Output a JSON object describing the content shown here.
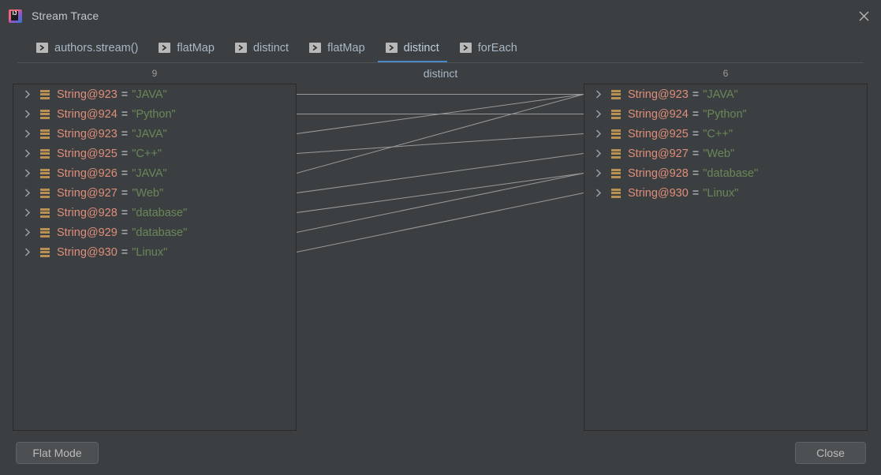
{
  "window": {
    "title": "Stream Trace",
    "app_icon": "intellij-idea-icon",
    "icon_text": "IJ",
    "close_icon": "close-icon"
  },
  "tabs": [
    {
      "label": "authors.stream()",
      "icon": "stream-step-icon",
      "active": false
    },
    {
      "label": "flatMap",
      "icon": "stream-step-icon",
      "active": false
    },
    {
      "label": "distinct",
      "icon": "stream-step-icon",
      "active": false
    },
    {
      "label": "flatMap",
      "icon": "stream-step-icon",
      "active": false
    },
    {
      "label": "distinct",
      "icon": "stream-step-icon",
      "active": true
    },
    {
      "label": "forEach",
      "icon": "stream-step-icon",
      "active": false
    }
  ],
  "stage": {
    "name": "distinct",
    "left_count": "9",
    "right_count": "6"
  },
  "left_panel": {
    "items": [
      {
        "name": "String@923",
        "eq": "=",
        "value": "\"JAVA\"",
        "icon": "string-object-icon",
        "chevron": "chevron-right-icon"
      },
      {
        "name": "String@924",
        "eq": "=",
        "value": "\"Python\"",
        "icon": "string-object-icon",
        "chevron": "chevron-right-icon"
      },
      {
        "name": "String@923",
        "eq": "=",
        "value": "\"JAVA\"",
        "icon": "string-object-icon",
        "chevron": "chevron-right-icon"
      },
      {
        "name": "String@925",
        "eq": "=",
        "value": "\"C++\"",
        "icon": "string-object-icon",
        "chevron": "chevron-right-icon"
      },
      {
        "name": "String@926",
        "eq": "=",
        "value": "\"JAVA\"",
        "icon": "string-object-icon",
        "chevron": "chevron-right-icon"
      },
      {
        "name": "String@927",
        "eq": "=",
        "value": "\"Web\"",
        "icon": "string-object-icon",
        "chevron": "chevron-right-icon"
      },
      {
        "name": "String@928",
        "eq": "=",
        "value": "\"database\"",
        "icon": "string-object-icon",
        "chevron": "chevron-right-icon"
      },
      {
        "name": "String@929",
        "eq": "=",
        "value": "\"database\"",
        "icon": "string-object-icon",
        "chevron": "chevron-right-icon"
      },
      {
        "name": "String@930",
        "eq": "=",
        "value": "\"Linux\"",
        "icon": "string-object-icon",
        "chevron": "chevron-right-icon"
      }
    ]
  },
  "right_panel": {
    "items": [
      {
        "name": "String@923",
        "eq": "=",
        "value": "\"JAVA\"",
        "icon": "string-object-icon",
        "chevron": "chevron-right-icon"
      },
      {
        "name": "String@924",
        "eq": "=",
        "value": "\"Python\"",
        "icon": "string-object-icon",
        "chevron": "chevron-right-icon"
      },
      {
        "name": "String@925",
        "eq": "=",
        "value": "\"C++\"",
        "icon": "string-object-icon",
        "chevron": "chevron-right-icon"
      },
      {
        "name": "String@927",
        "eq": "=",
        "value": "\"Web\"",
        "icon": "string-object-icon",
        "chevron": "chevron-right-icon"
      },
      {
        "name": "String@928",
        "eq": "=",
        "value": "\"database\"",
        "icon": "string-object-icon",
        "chevron": "chevron-right-icon"
      },
      {
        "name": "String@930",
        "eq": "=",
        "value": "\"Linux\"",
        "icon": "string-object-icon",
        "chevron": "chevron-right-icon"
      }
    ]
  },
  "links": [
    {
      "from": 0,
      "to": 0
    },
    {
      "from": 1,
      "to": 1
    },
    {
      "from": 2,
      "to": 0
    },
    {
      "from": 3,
      "to": 2
    },
    {
      "from": 4,
      "to": 0
    },
    {
      "from": 5,
      "to": 3
    },
    {
      "from": 6,
      "to": 4
    },
    {
      "from": 7,
      "to": 4
    },
    {
      "from": 8,
      "to": 5
    }
  ],
  "footer": {
    "flat_mode_label": "Flat Mode",
    "close_label": "Close"
  },
  "colors": {
    "background": "#3c3f41",
    "panel_border": "#2b2b2b",
    "accent": "#4a88c7",
    "object_name": "#e08e79",
    "string_value": "#6a8759",
    "string_icon": "#b89152",
    "link_line": "#9a9a9a",
    "text": "#a9b7c6"
  }
}
